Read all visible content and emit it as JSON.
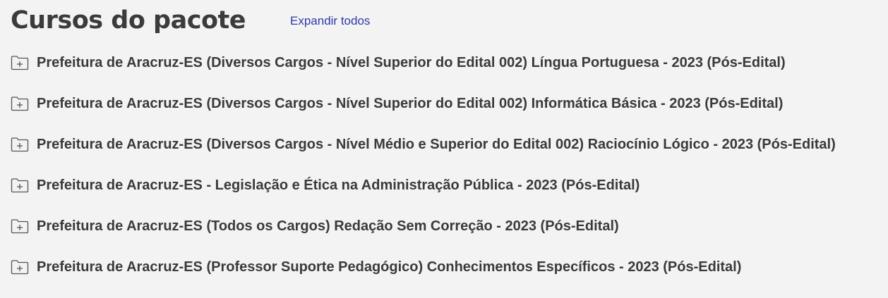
{
  "header": {
    "title": "Cursos do pacote",
    "expand_all_label": "Expandir todos"
  },
  "courses": [
    {
      "label": "Prefeitura de Aracruz-ES (Diversos Cargos - Nível Superior do Edital 002) Língua Portuguesa - 2023 (Pós-Edital)",
      "icon": "folder-plus-icon"
    },
    {
      "label": "Prefeitura de Aracruz-ES (Diversos Cargos - Nível Superior do Edital 002) Informática Básica - 2023 (Pós-Edital)",
      "icon": "folder-plus-icon"
    },
    {
      "label": "Prefeitura de Aracruz-ES (Diversos Cargos - Nível Médio e Superior do Edital 002) Raciocínio Lógico - 2023 (Pós-Edital)",
      "icon": "folder-plus-icon"
    },
    {
      "label": "Prefeitura de Aracruz-ES - Legislação e Ética na Administração Pública - 2023 (Pós-Edital)",
      "icon": "folder-plus-icon"
    },
    {
      "label": "Prefeitura de Aracruz-ES (Todos os Cargos) Redação Sem Correção - 2023 (Pós-Edital)",
      "icon": "folder-plus-icon"
    },
    {
      "label": "Prefeitura de Aracruz-ES (Professor Suporte Pedagógico) Conhecimentos Específicos - 2023 (Pós-Edital)",
      "icon": "folder-plus-icon"
    }
  ],
  "colors": {
    "background": "#f3f3f3",
    "text": "#3a3a3a",
    "link": "#2e3aa8"
  }
}
